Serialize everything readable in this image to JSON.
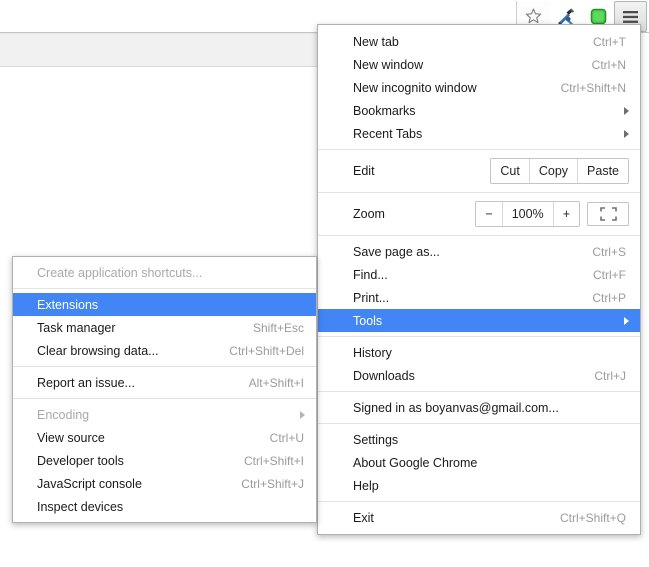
{
  "toolbar": {
    "buttons": [
      {
        "name": "bookmark-star-icon",
        "label": "Bookmark this page"
      },
      {
        "name": "tools-wrench-icon",
        "label": "Developer tools"
      },
      {
        "name": "green-square-extension-icon",
        "label": "Extension"
      },
      {
        "name": "chrome-menu-icon",
        "label": "Customize and control Google Chrome"
      }
    ]
  },
  "main_menu": {
    "groups": [
      {
        "items": [
          {
            "label": "New tab",
            "accel": "Ctrl+T",
            "submenu": false,
            "disabled": false,
            "highlighted": false
          },
          {
            "label": "New window",
            "accel": "Ctrl+N",
            "submenu": false,
            "disabled": false,
            "highlighted": false
          },
          {
            "label": "New incognito window",
            "accel": "Ctrl+Shift+N",
            "submenu": false,
            "disabled": false,
            "highlighted": false
          },
          {
            "label": "Bookmarks",
            "accel": "",
            "submenu": true,
            "disabled": false,
            "highlighted": false
          },
          {
            "label": "Recent Tabs",
            "accel": "",
            "submenu": true,
            "disabled": false,
            "highlighted": false
          }
        ]
      }
    ],
    "edit_row": {
      "label": "Edit",
      "buttons": [
        "Cut",
        "Copy",
        "Paste"
      ]
    },
    "zoom_row": {
      "label": "Zoom",
      "minus": "−",
      "level": "100%",
      "plus": "+",
      "fullscreen_icon": "fullscreen-icon"
    },
    "file_group": [
      {
        "label": "Save page as...",
        "accel": "Ctrl+S",
        "submenu": false,
        "disabled": false,
        "highlighted": false
      },
      {
        "label": "Find...",
        "accel": "Ctrl+F",
        "submenu": false,
        "disabled": false,
        "highlighted": false
      },
      {
        "label": "Print...",
        "accel": "Ctrl+P",
        "submenu": false,
        "disabled": false,
        "highlighted": false
      }
    ],
    "tools_item": {
      "label": "Tools",
      "accel": "",
      "submenu": true,
      "disabled": false,
      "highlighted": true
    },
    "history_group": [
      {
        "label": "History",
        "accel": "",
        "submenu": false,
        "disabled": false,
        "highlighted": false
      },
      {
        "label": "Downloads",
        "accel": "Ctrl+J",
        "submenu": false,
        "disabled": false,
        "highlighted": false
      }
    ],
    "account_group": [
      {
        "label": "Signed in as boyanvas@gmail.com...",
        "accel": "",
        "submenu": false,
        "disabled": false,
        "highlighted": false
      }
    ],
    "settings_group": [
      {
        "label": "Settings",
        "accel": "",
        "submenu": false,
        "disabled": false,
        "highlighted": false
      },
      {
        "label": "About Google Chrome",
        "accel": "",
        "submenu": false,
        "disabled": false,
        "highlighted": false
      },
      {
        "label": "Help",
        "accel": "",
        "submenu": false,
        "disabled": false,
        "highlighted": false
      }
    ],
    "exit_group": [
      {
        "label": "Exit",
        "accel": "Ctrl+Shift+Q",
        "submenu": false,
        "disabled": false,
        "highlighted": false
      }
    ]
  },
  "tools_submenu": {
    "group1": [
      {
        "label": "Create application shortcuts...",
        "accel": "",
        "submenu": false,
        "disabled": true,
        "highlighted": false
      }
    ],
    "group2": [
      {
        "label": "Extensions",
        "accel": "",
        "submenu": false,
        "disabled": false,
        "highlighted": true
      },
      {
        "label": "Task manager",
        "accel": "Shift+Esc",
        "submenu": false,
        "disabled": false,
        "highlighted": false
      },
      {
        "label": "Clear browsing data...",
        "accel": "Ctrl+Shift+Del",
        "submenu": false,
        "disabled": false,
        "highlighted": false
      }
    ],
    "group3": [
      {
        "label": "Report an issue...",
        "accel": "Alt+Shift+I",
        "submenu": false,
        "disabled": false,
        "highlighted": false
      }
    ],
    "group4": [
      {
        "label": "Encoding",
        "accel": "",
        "submenu": true,
        "disabled": true,
        "highlighted": false
      },
      {
        "label": "View source",
        "accel": "Ctrl+U",
        "submenu": false,
        "disabled": false,
        "highlighted": false
      },
      {
        "label": "Developer tools",
        "accel": "Ctrl+Shift+I",
        "submenu": false,
        "disabled": false,
        "highlighted": false
      },
      {
        "label": "JavaScript console",
        "accel": "Ctrl+Shift+J",
        "submenu": false,
        "disabled": false,
        "highlighted": false
      },
      {
        "label": "Inspect devices",
        "accel": "",
        "submenu": false,
        "disabled": false,
        "highlighted": false
      }
    ]
  },
  "colors": {
    "highlight": "#4285f4",
    "highlight_text": "#ffffff",
    "menu_background": "#ffffff",
    "menu_text": "#1a1a1a",
    "accel_text": "#9b9b9b",
    "disabled_text": "#a9a9a9",
    "separator": "#e4e4e4",
    "page_band": "#f1f1f1",
    "extension_green": "#4ec94e"
  }
}
